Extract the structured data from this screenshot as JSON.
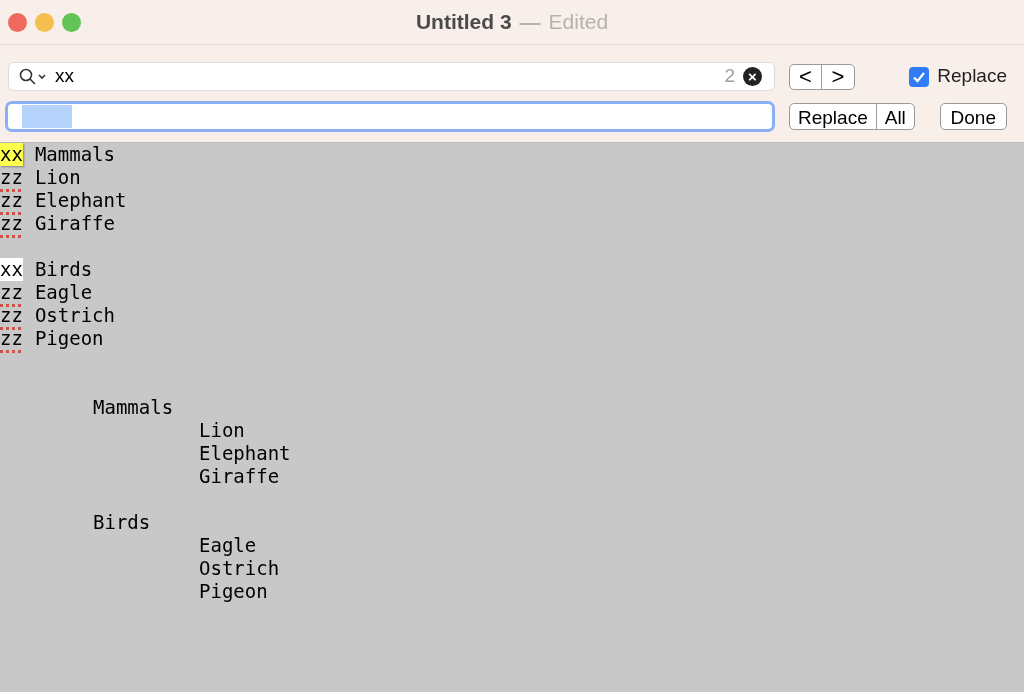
{
  "window": {
    "title": "Untitled 3",
    "separator": "—",
    "status": "Edited"
  },
  "find_bar": {
    "search": {
      "value": "xx",
      "match_count": "2",
      "clear": "×"
    },
    "replace_field": {
      "focused": true
    },
    "previous": "<",
    "next": ">",
    "replace_toggle": {
      "label": "Replace",
      "checked": true
    },
    "buttons": [
      "Replace",
      "All"
    ],
    "done": "Done"
  },
  "document": {
    "blocks": [
      {
        "lines": [
          {
            "marker": "xx",
            "kind": "current-match",
            "text": "Mammals"
          },
          {
            "marker": "zz",
            "kind": "misspelled",
            "text": "Lion"
          },
          {
            "marker": "zz",
            "kind": "misspelled",
            "text": "Elephant"
          },
          {
            "marker": "zz",
            "kind": "misspelled",
            "text": "Giraffe"
          }
        ]
      },
      {
        "lines": [
          {
            "marker": "xx",
            "kind": "match",
            "text": "Birds"
          },
          {
            "marker": "zz",
            "kind": "misspelled",
            "text": "Eagle"
          },
          {
            "marker": "zz",
            "kind": "misspelled",
            "text": "Ostrich"
          },
          {
            "marker": "zz",
            "kind": "misspelled",
            "text": "Pigeon"
          }
        ]
      }
    ],
    "outline": [
      {
        "text": "Mammals",
        "children": [
          {
            "text": "Lion"
          },
          {
            "text": "Elephant"
          },
          {
            "text": "Giraffe"
          }
        ]
      },
      {
        "text": "Birds",
        "children": [
          {
            "text": "Eagle"
          },
          {
            "text": "Ostrich"
          },
          {
            "text": "Pigeon"
          }
        ]
      }
    ]
  }
}
